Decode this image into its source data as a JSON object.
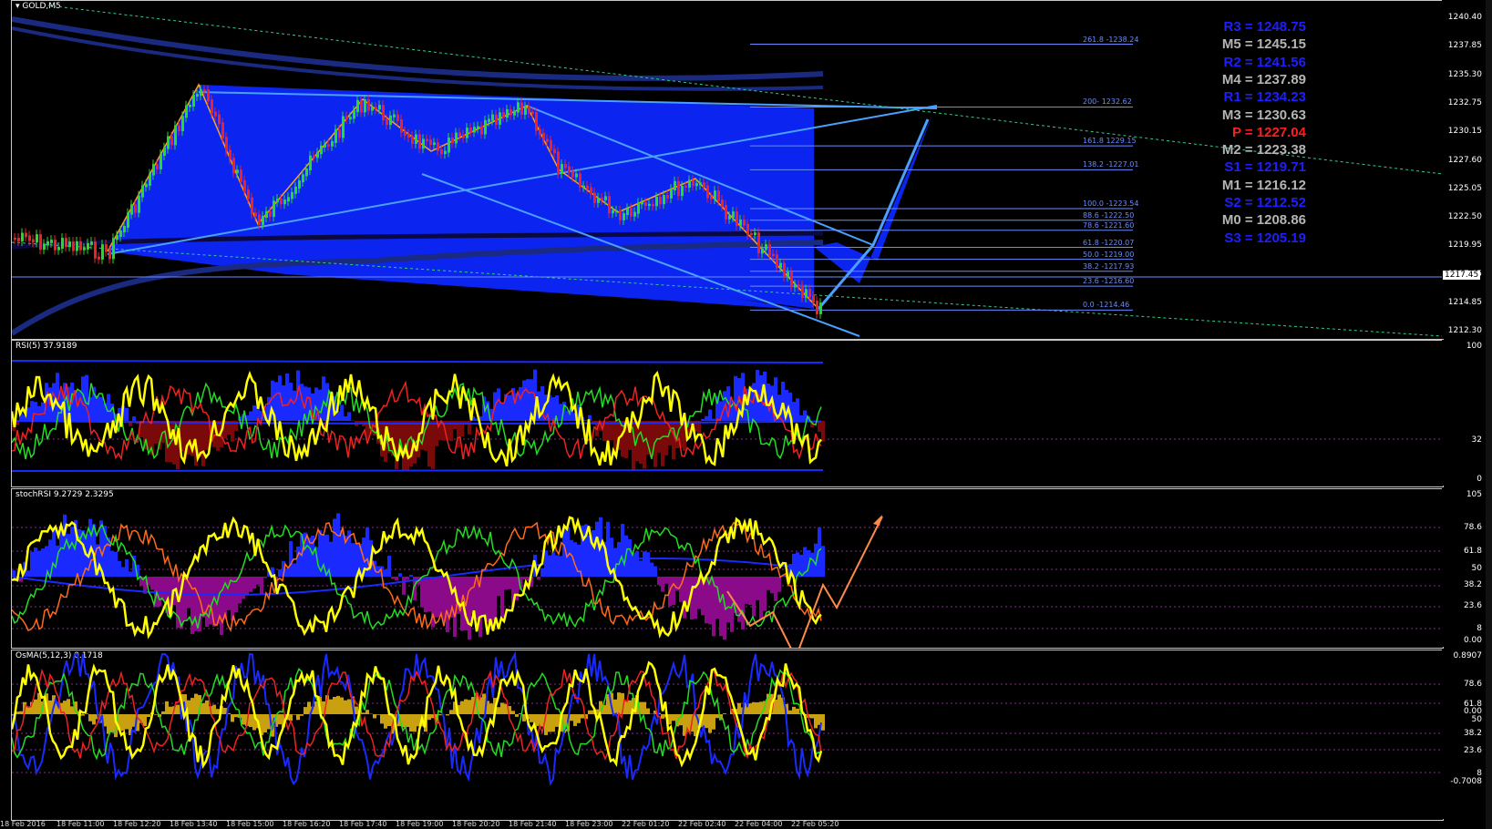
{
  "chart_data": {
    "type": "line",
    "symbol": "GOLD,M5",
    "price_axis": {
      "ticks": [
        "1240.40",
        "1237.85",
        "1235.30",
        "1232.75",
        "1230.15",
        "1227.60",
        "1225.05",
        "1222.50",
        "1219.95",
        "1217.45",
        "1214.85",
        "1212.30"
      ],
      "current": "1217.45"
    },
    "pivots": [
      {
        "label": "R3 = 1248.75",
        "color": "#1e1eff"
      },
      {
        "label": "M5 = 1245.15",
        "color": "#b4b4b4"
      },
      {
        "label": "R2 = 1241.56",
        "color": "#1e1eff"
      },
      {
        "label": "M4 = 1237.89",
        "color": "#b4b4b4"
      },
      {
        "label": "R1 = 1234.23",
        "color": "#1e1eff"
      },
      {
        "label": "M3 = 1230.63",
        "color": "#b4b4b4"
      },
      {
        "label": "P  = 1227.04",
        "color": "#ff1e1e"
      },
      {
        "label": "M2 = 1223.38",
        "color": "#b4b4b4"
      },
      {
        "label": "S1 = 1219.71",
        "color": "#1e1eff"
      },
      {
        "label": "M1 = 1216.12",
        "color": "#b4b4b4"
      },
      {
        "label": "S2 = 1212.52",
        "color": "#1e1eff"
      },
      {
        "label": "M0 = 1208.86",
        "color": "#b4b4b4"
      },
      {
        "label": "S3 = 1205.19",
        "color": "#1e1eff"
      }
    ],
    "fib_levels": [
      "261.8 -1238.24",
      "200- 1232.62",
      "161.8 1229.15",
      "138.2 -1227.01",
      "100.0 -1223.54",
      "88.6 -1222.50",
      "78.6 -1221.60",
      "61.8 -1220.07",
      "50.0 -1219.00",
      "38.2 -1217.93",
      "23.6 -1216.60",
      "0.0 -1214.46"
    ],
    "indicators": [
      {
        "label": "RSI(5) 37.9189",
        "scale": [
          "100",
          "32",
          "0"
        ]
      },
      {
        "label": "stochRSI 9.2729 2.3295",
        "scale": [
          "105",
          "78.6",
          "61.8",
          "50",
          "38.2",
          "23.6",
          "8",
          "0.00"
        ]
      },
      {
        "label": "OsMA(5,12,3) 0.1718",
        "scale": [
          "0.8907",
          "78.6",
          "61.8",
          "0.00",
          "50",
          "38.2",
          "23.6",
          "8",
          "-0.7008"
        ]
      }
    ],
    "time_labels": [
      "18 Feb 2016",
      "18 Feb 11:00",
      "18 Feb 12:20",
      "18 Feb 13:40",
      "18 Feb 15:00",
      "18 Feb 16:20",
      "18 Feb 17:40",
      "18 Feb 19:00",
      "18 Feb 20:20",
      "18 Feb 21:40",
      "18 Feb 23:00",
      "22 Feb 01:20",
      "22 Feb 02:40",
      "22 Feb 04:00",
      "22 Feb 05:20"
    ]
  }
}
